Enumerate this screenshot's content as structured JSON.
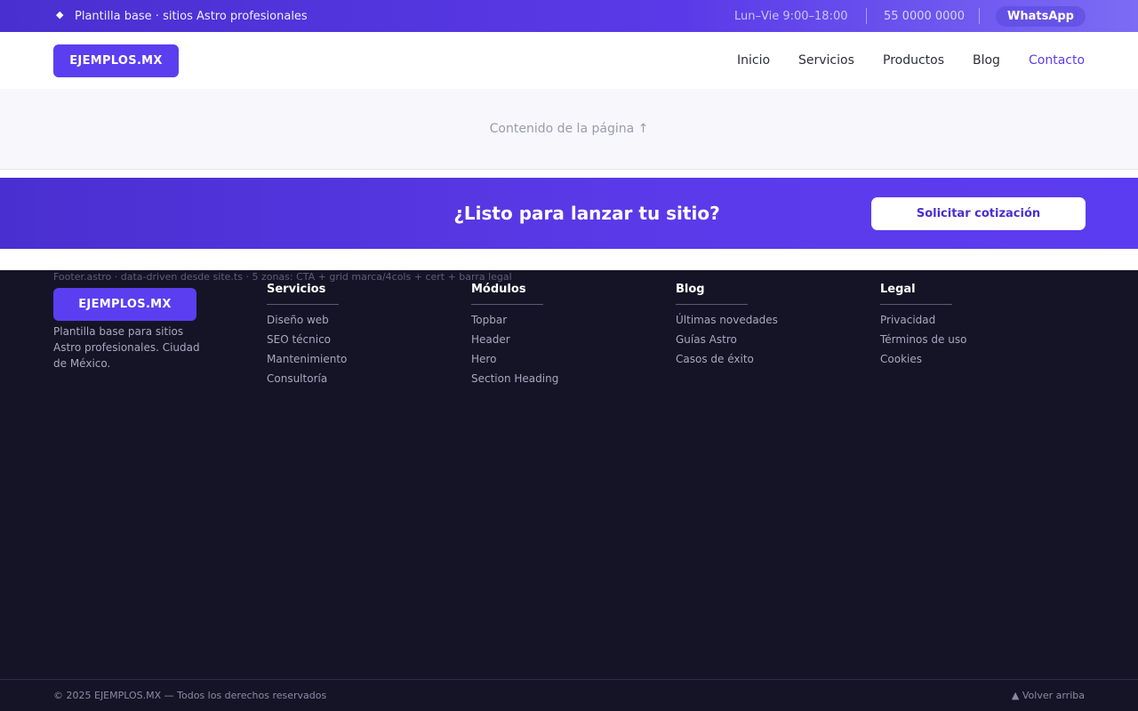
{
  "topbar": {
    "tagline": "Plantilla base · sitios Astro profesionales",
    "hours": "Lun–Vie  9:00–18:00",
    "phone": "55 0000 0000",
    "whatsapp": "WhatsApp"
  },
  "header": {
    "logo": "EJEMPLOS.MX",
    "nav": [
      {
        "label": "Inicio"
      },
      {
        "label": "Servicios"
      },
      {
        "label": "Productos"
      },
      {
        "label": "Blog"
      },
      {
        "label": "Contacto",
        "active": true
      }
    ]
  },
  "content": {
    "placeholder": "Contenido de la página ↑"
  },
  "cta": {
    "heading": "¿Listo para lanzar tu sitio?",
    "button": "Solicitar cotización"
  },
  "footer": {
    "note": "Footer.astro  ·  data-driven desde site.ts  ·  5 zonas: CTA + grid marca/4cols + cert + barra legal",
    "logo": "EJEMPLOS.MX",
    "description": "Plantilla base para sitios Astro profesionales. Ciudad de México.",
    "columns": [
      {
        "title": "Servicios",
        "links": [
          "Diseño web",
          "SEO técnico",
          "Mantenimiento",
          "Consultoría"
        ]
      },
      {
        "title": "Módulos",
        "links": [
          "Topbar",
          "Header",
          "Hero",
          "Section Heading"
        ]
      },
      {
        "title": "Blog",
        "links": [
          "Últimas novedades",
          "Guías Astro",
          "Casos de éxito"
        ]
      },
      {
        "title": "Legal",
        "links": [
          "Privacidad",
          "Términos de uso",
          "Cookies"
        ]
      }
    ]
  },
  "legal": {
    "copyright": "© 2025 EJEMPLOS.MX — Todos los derechos reservados",
    "back_to_top": "▲ Volver arriba"
  },
  "colors": {
    "accent": "#5b3ef0",
    "footer_bg": "#151426"
  }
}
